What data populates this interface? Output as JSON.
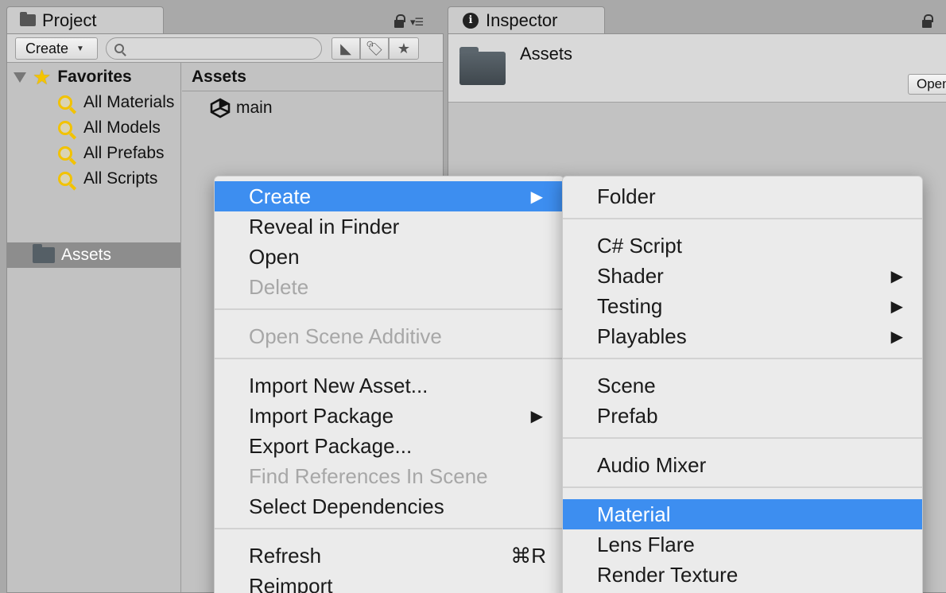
{
  "project": {
    "tab_label": "Project",
    "toolbar": {
      "create_label": "Create"
    },
    "favorites": {
      "title": "Favorites",
      "items": [
        "All Materials",
        "All Models",
        "All Prefabs",
        "All Scripts"
      ]
    },
    "assets_tree_label": "Assets",
    "assets_header": "Assets",
    "asset_items": [
      "main"
    ]
  },
  "inspector": {
    "tab_label": "Inspector",
    "title": "Assets",
    "open_button": "Open"
  },
  "context_menu": {
    "items": [
      {
        "label": "Create",
        "state": "highlighted",
        "submenu": true
      },
      {
        "label": "Reveal in Finder"
      },
      {
        "label": "Open"
      },
      {
        "label": "Delete",
        "state": "disabled"
      },
      {
        "label": "Open Scene Additive",
        "state": "disabled"
      },
      {
        "label": "Import New Asset..."
      },
      {
        "label": "Import Package",
        "submenu": true
      },
      {
        "label": "Export Package..."
      },
      {
        "label": "Find References In Scene",
        "state": "disabled"
      },
      {
        "label": "Select Dependencies"
      },
      {
        "label": "Refresh",
        "shortcut": "⌘R"
      },
      {
        "label": "Reimport"
      }
    ]
  },
  "create_submenu": {
    "items": [
      {
        "label": "Folder"
      },
      {
        "label": "C# Script"
      },
      {
        "label": "Shader",
        "submenu": true
      },
      {
        "label": "Testing",
        "submenu": true
      },
      {
        "label": "Playables",
        "submenu": true
      },
      {
        "label": "Scene"
      },
      {
        "label": "Prefab"
      },
      {
        "label": "Audio Mixer"
      },
      {
        "label": "Material",
        "state": "highlighted"
      },
      {
        "label": "Lens Flare"
      },
      {
        "label": "Render Texture"
      }
    ]
  },
  "colors": {
    "highlight": "#3d8ef0",
    "favorites_icon": "#f4c400",
    "selected_row": "#8d8d8d"
  }
}
